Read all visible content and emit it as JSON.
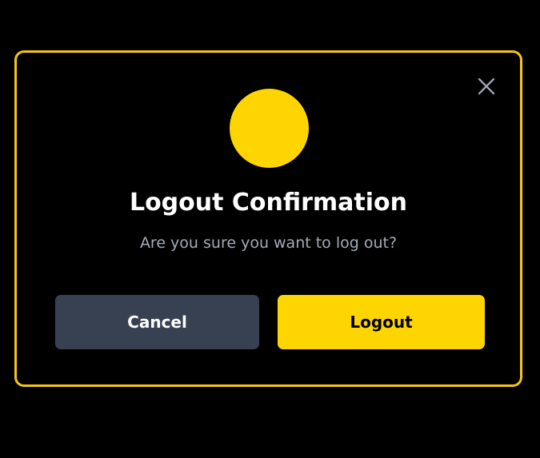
{
  "dialog": {
    "title": "Logout Confirmation",
    "message": "Are you sure you want to log out?",
    "close_icon": "close-icon",
    "cancel_label": "Cancel",
    "confirm_label": "Logout"
  },
  "colors": {
    "background": "#000000",
    "accent": "#ffd500",
    "border": "#f5c518",
    "cancel_bg": "#384152",
    "message_text": "#a3acb9",
    "close_icon": "#9aa3b0"
  }
}
